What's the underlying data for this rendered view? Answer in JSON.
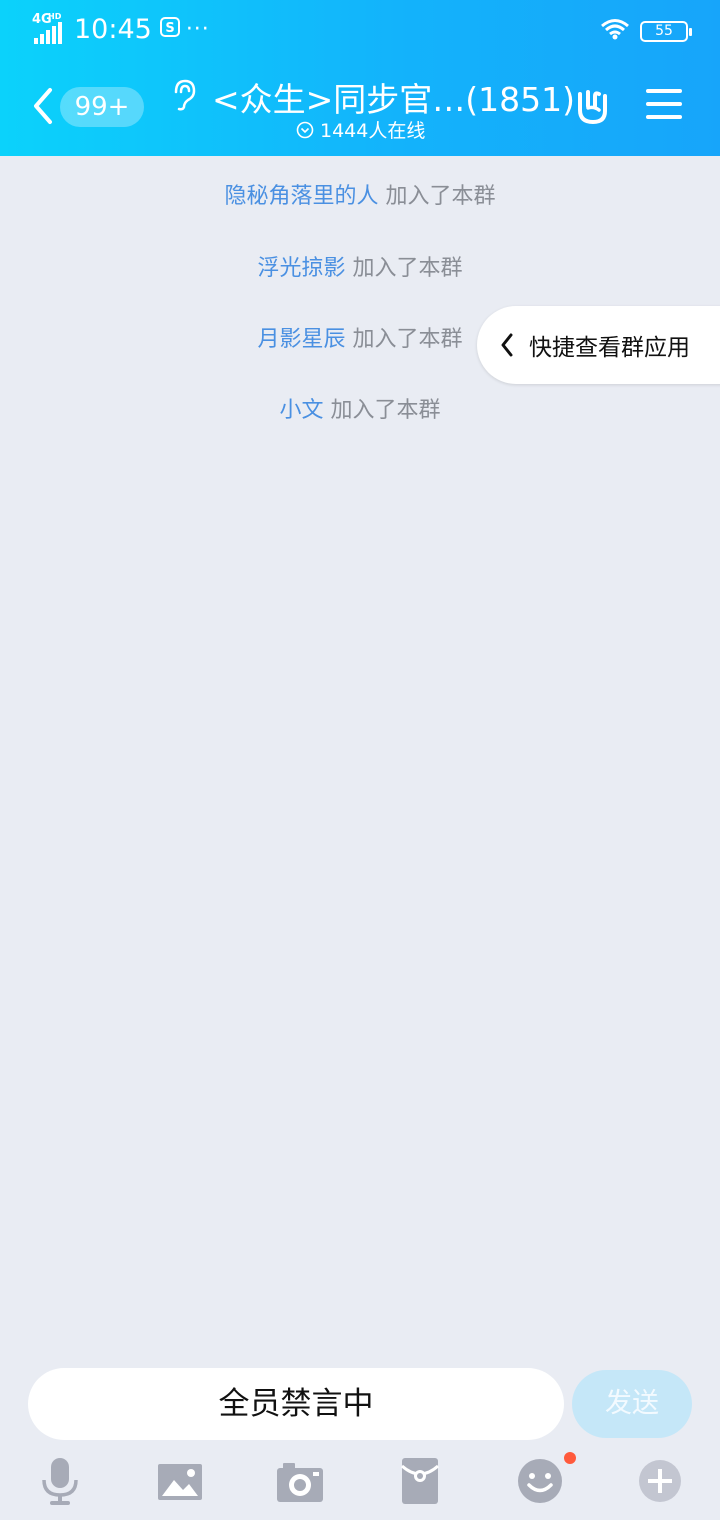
{
  "status_bar": {
    "network": "4G",
    "network_extra": "HD",
    "time": "10:45",
    "dots": "···",
    "battery": "55"
  },
  "header": {
    "unread_badge": "99+",
    "title": "<众生>同步官…(1851)",
    "online": "1444人在线"
  },
  "messages": [
    {
      "name": "隐秘角落里的人",
      "text": " 加入了本群"
    },
    {
      "name": "浮光掠影",
      "text": " 加入了本群"
    },
    {
      "name": "月影星辰",
      "text": " 加入了本群"
    },
    {
      "name": "小文",
      "text": " 加入了本群"
    }
  ],
  "quick_panel": {
    "label": "快捷查看群应用"
  },
  "input": {
    "muted_text": "全员禁言中",
    "send_label": "发送"
  },
  "toolbar": [
    "mic-icon",
    "image-icon",
    "camera-icon",
    "red-packet-icon",
    "emoji-icon",
    "plus-icon"
  ],
  "colors": {
    "header_start": "#0bd2fb",
    "header_end": "#17a5fa",
    "name_link": "#4a90e2",
    "background": "#e9ecf3"
  }
}
